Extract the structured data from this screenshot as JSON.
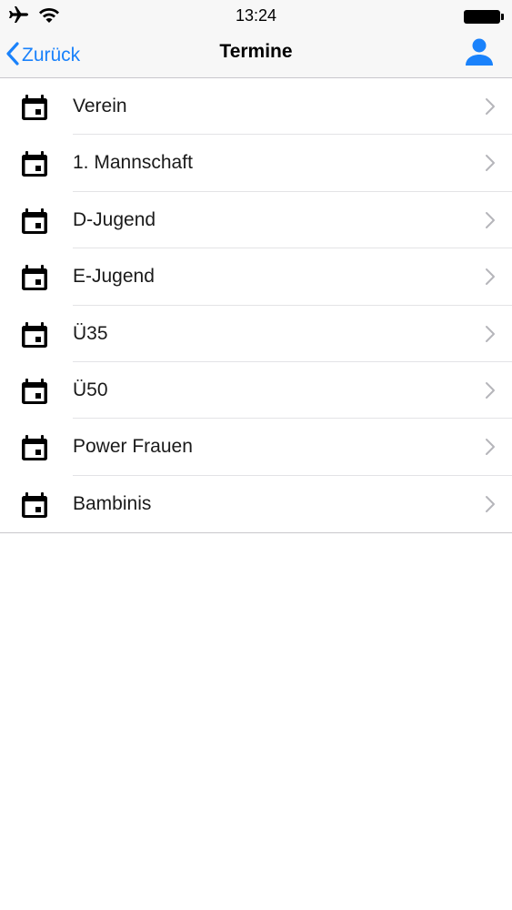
{
  "status_bar": {
    "time": "13:24",
    "icons": [
      "airplane-icon",
      "wifi-icon",
      "battery-icon"
    ]
  },
  "nav": {
    "back_label": "Zurück",
    "title": "Termine",
    "right_icon": "person-icon"
  },
  "colors": {
    "accent": "#1a82fb",
    "separator": "#e3e3e6",
    "chevron": "#b5b5ba"
  },
  "list": {
    "items": [
      {
        "label": "Verein",
        "icon": "calendar-icon"
      },
      {
        "label": "1. Mannschaft",
        "icon": "calendar-icon"
      },
      {
        "label": "D-Jugend",
        "icon": "calendar-icon"
      },
      {
        "label": "E-Jugend",
        "icon": "calendar-icon"
      },
      {
        "label": "Ü35",
        "icon": "calendar-icon"
      },
      {
        "label": "Ü50",
        "icon": "calendar-icon"
      },
      {
        "label": "Power Frauen",
        "icon": "calendar-icon"
      },
      {
        "label": "Bambinis",
        "icon": "calendar-icon"
      }
    ]
  }
}
